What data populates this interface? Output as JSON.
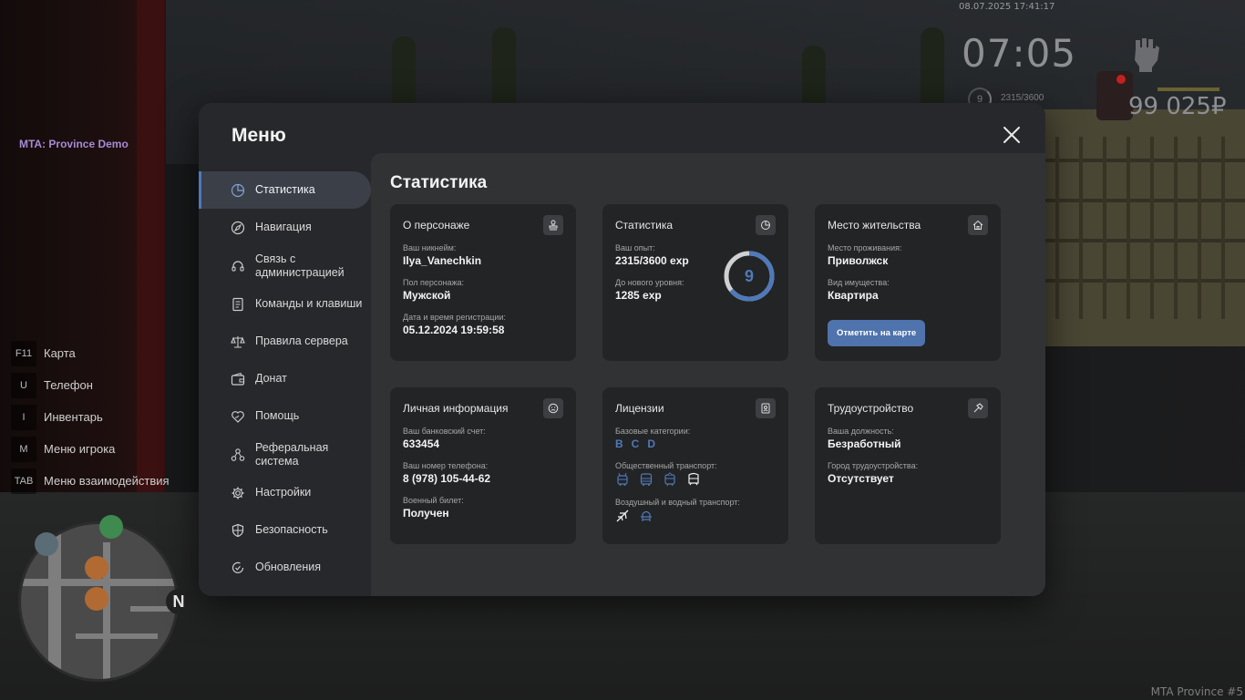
{
  "hud": {
    "timestamp": "08.07.2025 17:41:17",
    "clock": "07:05",
    "level": "9",
    "exp": "2315/3600",
    "money": "99 025₽",
    "server_name": "MTA: Province Demo",
    "server_footer": "MTA Province #5",
    "map_north": "N"
  },
  "hotkeys": [
    {
      "key": "F11",
      "label": "Карта"
    },
    {
      "key": "U",
      "label": "Телефон"
    },
    {
      "key": "I",
      "label": "Инвентарь"
    },
    {
      "key": "M",
      "label": "Меню игрока"
    },
    {
      "key": "TAB",
      "label": "Меню взаимодействия"
    }
  ],
  "menu": {
    "title": "Меню",
    "sidebar": [
      {
        "label": "Статистика",
        "icon": "pie-chart-icon",
        "active": true
      },
      {
        "label": "Навигация",
        "icon": "compass-icon"
      },
      {
        "label": "Связь с администрацией",
        "icon": "headset-icon"
      },
      {
        "label": "Команды и клавиши",
        "icon": "document-icon"
      },
      {
        "label": "Правила сервера",
        "icon": "scales-icon"
      },
      {
        "label": "Донат",
        "icon": "wallet-icon"
      },
      {
        "label": "Помощь",
        "icon": "heart-hand-icon"
      },
      {
        "label": "Реферальная система",
        "icon": "referral-icon"
      },
      {
        "label": "Настройки",
        "icon": "gear-icon"
      },
      {
        "label": "Безопасность",
        "icon": "shield-icon"
      },
      {
        "label": "Обновления",
        "icon": "refresh-check-icon"
      }
    ]
  },
  "content": {
    "title": "Статистика",
    "cards": {
      "character": {
        "title": "О персонаже",
        "nickname_label": "Ваш никнейм:",
        "nickname": "Ilya_Vanechkin",
        "gender_label": "Пол персонажа:",
        "gender": "Мужской",
        "reg_label": "Дата и время регистрации:",
        "reg_date": "05.12.2024 19:59:58"
      },
      "stats": {
        "title": "Статистика",
        "exp_label": "Ваш опыт:",
        "exp": "2315/3600 exp",
        "next_label": "До нового уровня:",
        "next": "1285 exp",
        "level": "9",
        "progress": 0.643
      },
      "residence": {
        "title": "Место жительства",
        "place_label": "Место проживания:",
        "place": "Приволжск",
        "property_label": "Вид имущества:",
        "property": "Квартира",
        "map_button": "Отметить на карте"
      },
      "personal": {
        "title": "Личная информация",
        "bank_label": "Ваш банковский счет:",
        "bank": "633454",
        "phone_label": "Ваш номер телефона:",
        "phone": "8 (978) 105-44-62",
        "military_label": "Военный билет:",
        "military": "Получен"
      },
      "licenses": {
        "title": "Лицензии",
        "base_label": "Базовые категории:",
        "base": [
          "B",
          "C",
          "D"
        ],
        "public_label": "Общественный транспорт:",
        "air_label": "Воздушный и водный транспорт:"
      },
      "employment": {
        "title": "Трудоустройство",
        "position_label": "Ваша должность:",
        "position": "Безработный",
        "city_label": "Город трудоустройства:",
        "city": "Отсутствует"
      }
    }
  },
  "colors": {
    "accent": "#4f79b9",
    "modal_bg": "#27282b",
    "content_bg": "#313234",
    "card_bg": "#232426"
  }
}
